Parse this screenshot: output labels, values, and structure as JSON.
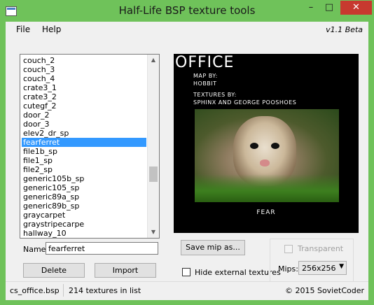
{
  "window": {
    "title": "Half-Life BSP texture tools"
  },
  "titlebar": {
    "minimize": "–",
    "maximize": "□",
    "close": "✕"
  },
  "menu": {
    "file": "File",
    "help": "Help",
    "version": "v1.1 Beta"
  },
  "list": {
    "items": [
      "couch_2",
      "couch_3",
      "couch_4",
      "crate3_1",
      "crate3_2",
      "cutegf_2",
      "door_2",
      "door_3",
      "elev2_dr_sp",
      "fearferret",
      "file1b_sp",
      "file1_sp",
      "file2_sp",
      "generic105b_sp",
      "generic105_sp",
      "generic89a_sp",
      "generic89b_sp",
      "graycarpet",
      "graystripecarpe",
      "hallway_10"
    ],
    "selected": "fearferret"
  },
  "name_field": {
    "label": "Name:",
    "value": "fearferret"
  },
  "buttons": {
    "delete": "Delete",
    "import": "Import",
    "save_mip": "Save mip as..."
  },
  "preview": {
    "title": "OFFICE",
    "map_by_label": "MAP BY:",
    "map_by": "HOBBIT",
    "textures_by_label": "TEXTURES BY:",
    "textures_by": "SPHINX AND  GEORGE POOSHOES",
    "caption": "FEAR"
  },
  "options": {
    "hide_external_label": "Hide external textures",
    "hide_external_checked": false,
    "transparent_label": "Transparent",
    "transparent_checked": false,
    "transparent_enabled": false,
    "mips_label": "Mips:",
    "mips_value": "256x256"
  },
  "status": {
    "file": "cs_office.bsp",
    "count_text": "214 textures in list",
    "copyright": "© 2015 SovietCoder"
  },
  "colors": {
    "titlebar": "#6fc25a",
    "close": "#c7392f",
    "selection": "#3399ff"
  }
}
